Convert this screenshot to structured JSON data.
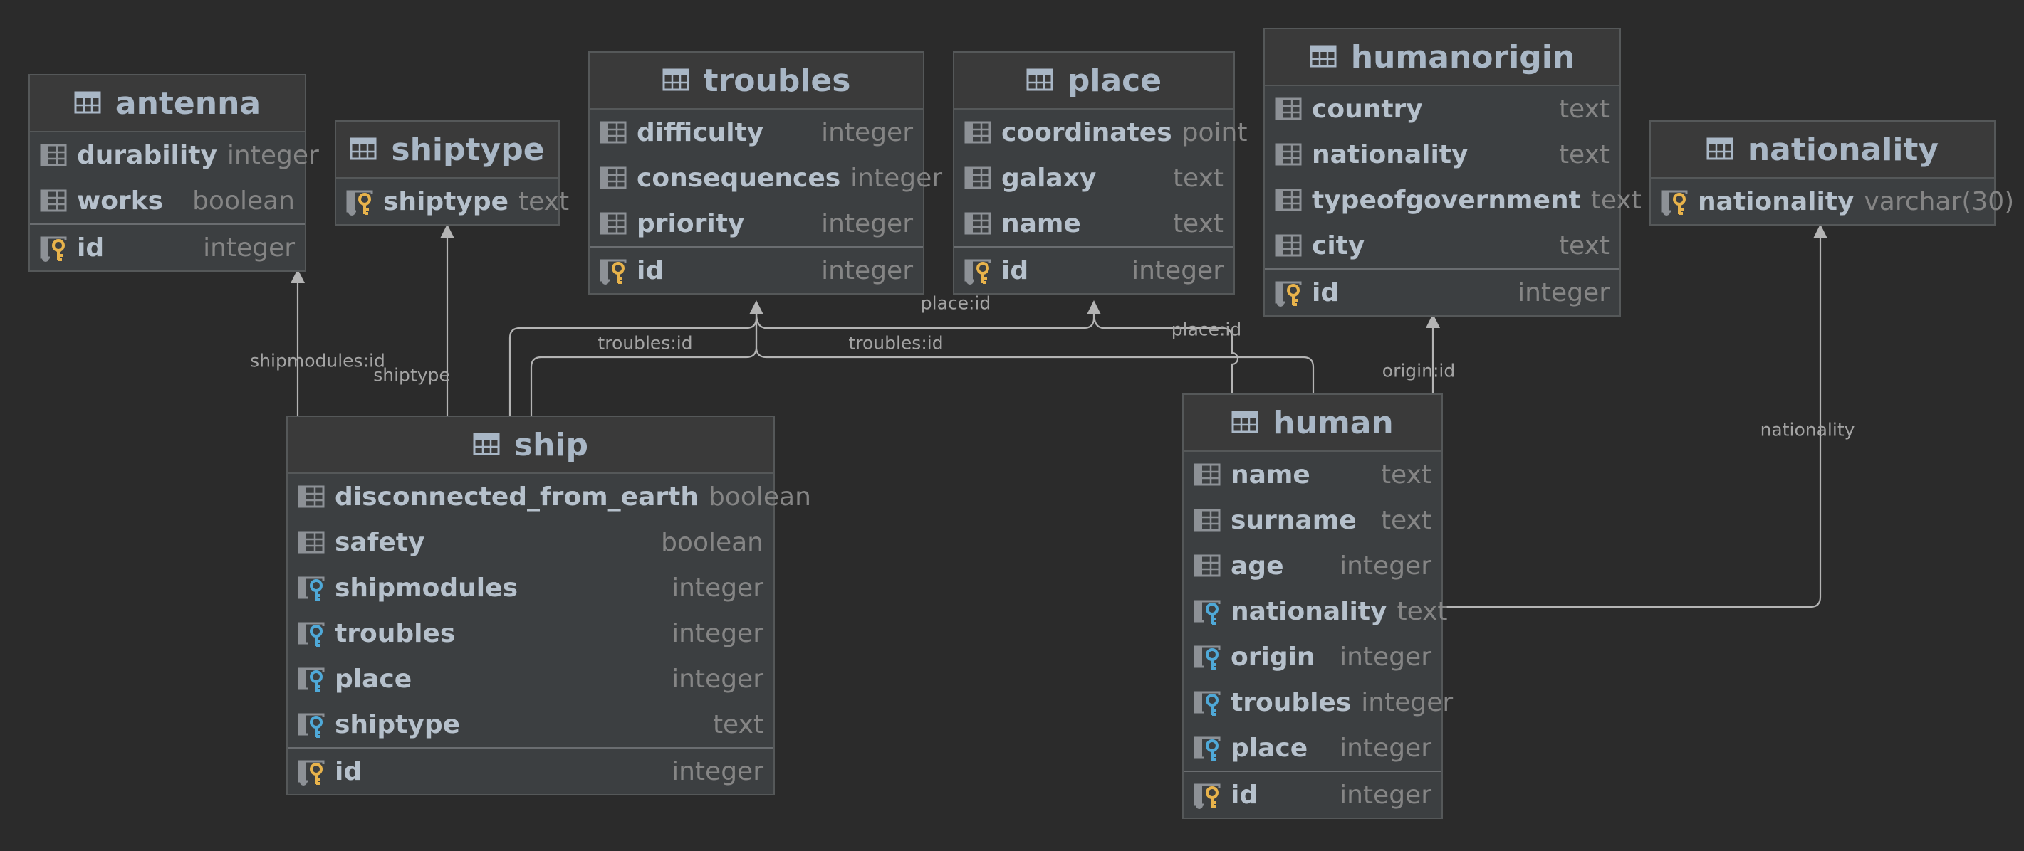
{
  "tables": [
    {
      "key": "antenna",
      "name": "antenna",
      "columns": [
        {
          "name": "durability",
          "type": "integer",
          "kind": "col"
        },
        {
          "name": "works",
          "type": "boolean",
          "kind": "col"
        }
      ],
      "pk": {
        "name": "id",
        "type": "integer"
      }
    },
    {
      "key": "shiptype",
      "name": "shiptype",
      "columns": [],
      "pk": {
        "name": "shiptype",
        "type": "text"
      }
    },
    {
      "key": "troubles",
      "name": "troubles",
      "columns": [
        {
          "name": "difficulty",
          "type": "integer",
          "kind": "col"
        },
        {
          "name": "consequences",
          "type": "integer",
          "kind": "col"
        },
        {
          "name": "priority",
          "type": "integer",
          "kind": "col"
        }
      ],
      "pk": {
        "name": "id",
        "type": "integer"
      }
    },
    {
      "key": "place",
      "name": "place",
      "columns": [
        {
          "name": "coordinates",
          "type": "point",
          "kind": "col"
        },
        {
          "name": "galaxy",
          "type": "text",
          "kind": "col"
        },
        {
          "name": "name",
          "type": "text",
          "kind": "col"
        }
      ],
      "pk": {
        "name": "id",
        "type": "integer"
      }
    },
    {
      "key": "humanorigin",
      "name": "humanorigin",
      "columns": [
        {
          "name": "country",
          "type": "text",
          "kind": "col"
        },
        {
          "name": "nationality",
          "type": "text",
          "kind": "col"
        },
        {
          "name": "typeofgovernment",
          "type": "text",
          "kind": "col"
        },
        {
          "name": "city",
          "type": "text",
          "kind": "col"
        }
      ],
      "pk": {
        "name": "id",
        "type": "integer"
      }
    },
    {
      "key": "nationality",
      "name": "nationality",
      "columns": [],
      "pk": {
        "name": "nationality",
        "type": "varchar(30)"
      }
    },
    {
      "key": "ship",
      "name": "ship",
      "columns": [
        {
          "name": "disconnected_from_earth",
          "type": "boolean",
          "kind": "col"
        },
        {
          "name": "safety",
          "type": "boolean",
          "kind": "col"
        },
        {
          "name": "shipmodules",
          "type": "integer",
          "kind": "fk"
        },
        {
          "name": "troubles",
          "type": "integer",
          "kind": "fk"
        },
        {
          "name": "place",
          "type": "integer",
          "kind": "fk"
        },
        {
          "name": "shiptype",
          "type": "text",
          "kind": "fk"
        }
      ],
      "pk": {
        "name": "id",
        "type": "integer"
      }
    },
    {
      "key": "human",
      "name": "human",
      "columns": [
        {
          "name": "name",
          "type": "text",
          "kind": "col"
        },
        {
          "name": "surname",
          "type": "text",
          "kind": "col"
        },
        {
          "name": "age",
          "type": "integer",
          "kind": "col"
        },
        {
          "name": "nationality",
          "type": "text",
          "kind": "fk"
        },
        {
          "name": "origin",
          "type": "integer",
          "kind": "fk"
        },
        {
          "name": "troubles",
          "type": "integer",
          "kind": "fk"
        },
        {
          "name": "place",
          "type": "integer",
          "kind": "fk"
        }
      ],
      "pk": {
        "name": "id",
        "type": "integer"
      }
    }
  ],
  "relations": [
    {
      "label": "shipmodules:id",
      "from": "ship",
      "to": "antenna"
    },
    {
      "label": "shiptype",
      "from": "ship",
      "to": "shiptype"
    },
    {
      "label": "troubles:id",
      "from": "ship",
      "to": "troubles"
    },
    {
      "label": "place:id",
      "from": "ship",
      "to": "place"
    },
    {
      "label": "troubles:id",
      "from": "human",
      "to": "troubles"
    },
    {
      "label": "place:id",
      "from": "human",
      "to": "place"
    },
    {
      "label": "origin:id",
      "from": "human",
      "to": "humanorigin"
    },
    {
      "label": "nationality",
      "from": "human",
      "to": "nationality"
    }
  ],
  "colors": {
    "background": "#2b2b2b",
    "table_body": "#3c3f41",
    "table_header": "#3a3a3a",
    "column_name": "#b6c1cc",
    "column_type": "#858585",
    "wire": "#b4b4b4",
    "key_gold": "#e8b34b",
    "foreign_key_blue": "#4fa9d8"
  }
}
